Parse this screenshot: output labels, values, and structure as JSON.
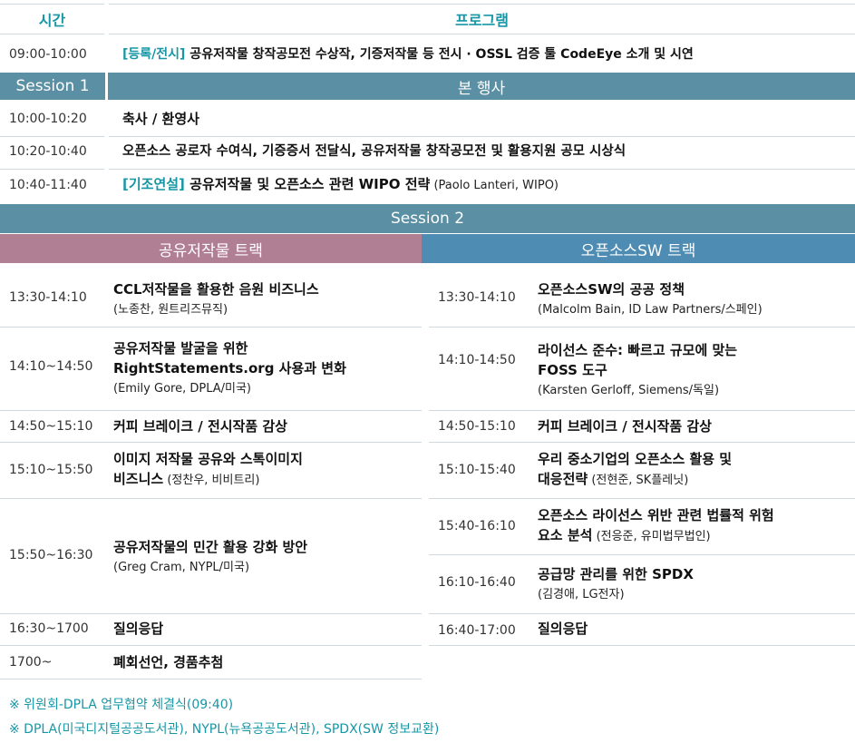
{
  "colors": {
    "accent": "#1797a6",
    "session_band": "#5b8fa3",
    "public_track": "#b07f93",
    "oss_track": "#4f8cb3"
  },
  "header": {
    "time": "시간",
    "program": "프로그램"
  },
  "r0": {
    "time": "09:00-10:00",
    "tag": "[등록/전시]",
    "text": " 공유저작물 창작공모전 수상작, 기증저작물 등 전시 · OSSL 검증 툴 CodeEye 소개 및 시연"
  },
  "session1": {
    "label": "Session 1",
    "title": "본 행사"
  },
  "s1": [
    {
      "time": "10:00-10:20",
      "text": "축사 / 환영사"
    },
    {
      "time": "10:20-10:40",
      "text": "오픈소스 공로자 수여식, 기증증서 전달식, 공유저작물 창작공모전 및 활용지원 공모 시상식"
    },
    {
      "time": "10:40-11:40",
      "tag": "[기조연설]",
      "text": " 공유저작물 및 오픈소스 관련 WIPO 전략",
      "sub": " (Paolo Lanteri, WIPO)"
    }
  ],
  "session2": {
    "title": "Session 2",
    "left_track": "공유저작물 트랙",
    "right_track": "오픈소스SW 트랙"
  },
  "left": [
    {
      "time": "13:30-14:10",
      "lines": [
        "CCL저작물을 활용한 음원 비즈니스"
      ],
      "sub": "(노종찬, 원트리즈뮤직)"
    },
    {
      "time": "14:10~14:50",
      "lines": [
        "공유저작물 발굴을 위한",
        "RightStatements.org 사용과 변화"
      ],
      "sub": "(Emily Gore, DPLA/미국)"
    },
    {
      "time": "14:50~15:10",
      "lines": [
        "커피 브레이크 / 전시작품 감상"
      ]
    },
    {
      "time": "15:10~15:50",
      "lines": [
        "이미지 저작물 공유와 스톡이미지"
      ],
      "last": "비즈니스",
      "inline_sub": " (정찬우, 비비트리)"
    },
    {
      "time": "15:50~16:30",
      "lines": [
        "공유저작물의 민간 활용 강화 방안"
      ],
      "sub": "(Greg Cram, NYPL/미국)"
    },
    {
      "time": "16:30~1700",
      "lines": [
        "질의응답"
      ]
    },
    {
      "time": "1700~",
      "lines": [
        "폐회선언, 경품추첨"
      ]
    }
  ],
  "right": [
    {
      "time": "13:30-14:10",
      "lines": [
        "오픈소스SW의 공공 정책"
      ],
      "sub": "(Malcolm Bain, ID Law Partners/스페인)"
    },
    {
      "time": "14:10-14:50",
      "lines": [
        "라이선스 준수: 빠르고 규모에 맞는",
        "FOSS 도구"
      ],
      "sub": "(Karsten Gerloff, Siemens/독일)"
    },
    {
      "time": "14:50-15:10",
      "lines": [
        "커피 브레이크 / 전시작품 감상"
      ]
    },
    {
      "time": "15:10-15:40",
      "lines": [
        "우리 중소기업의 오픈소스 활용 및"
      ],
      "last": "대응전략",
      "inline_sub": " (전현준, SK플레닛)"
    },
    {
      "time": "15:40-16:10",
      "lines": [
        "오픈소스 라이선스 위반 관련 법률적 위험"
      ],
      "last": "요소 분석",
      "inline_sub": " (전응준, 유미법무법인)"
    },
    {
      "time": "16:10-16:40",
      "lines": [
        "공급망 관리를 위한 SPDX"
      ],
      "sub": "(김경애, LG전자)"
    },
    {
      "time": "16:40-17:00",
      "lines": [
        "질의응답"
      ]
    }
  ],
  "notes": [
    "※ 위원회-DPLA 업무협약 체결식(09:40)",
    "※ DPLA(미국디지털공공도서관), NYPL(뉴욕공공도서관), SPDX(SW 정보교환)"
  ]
}
